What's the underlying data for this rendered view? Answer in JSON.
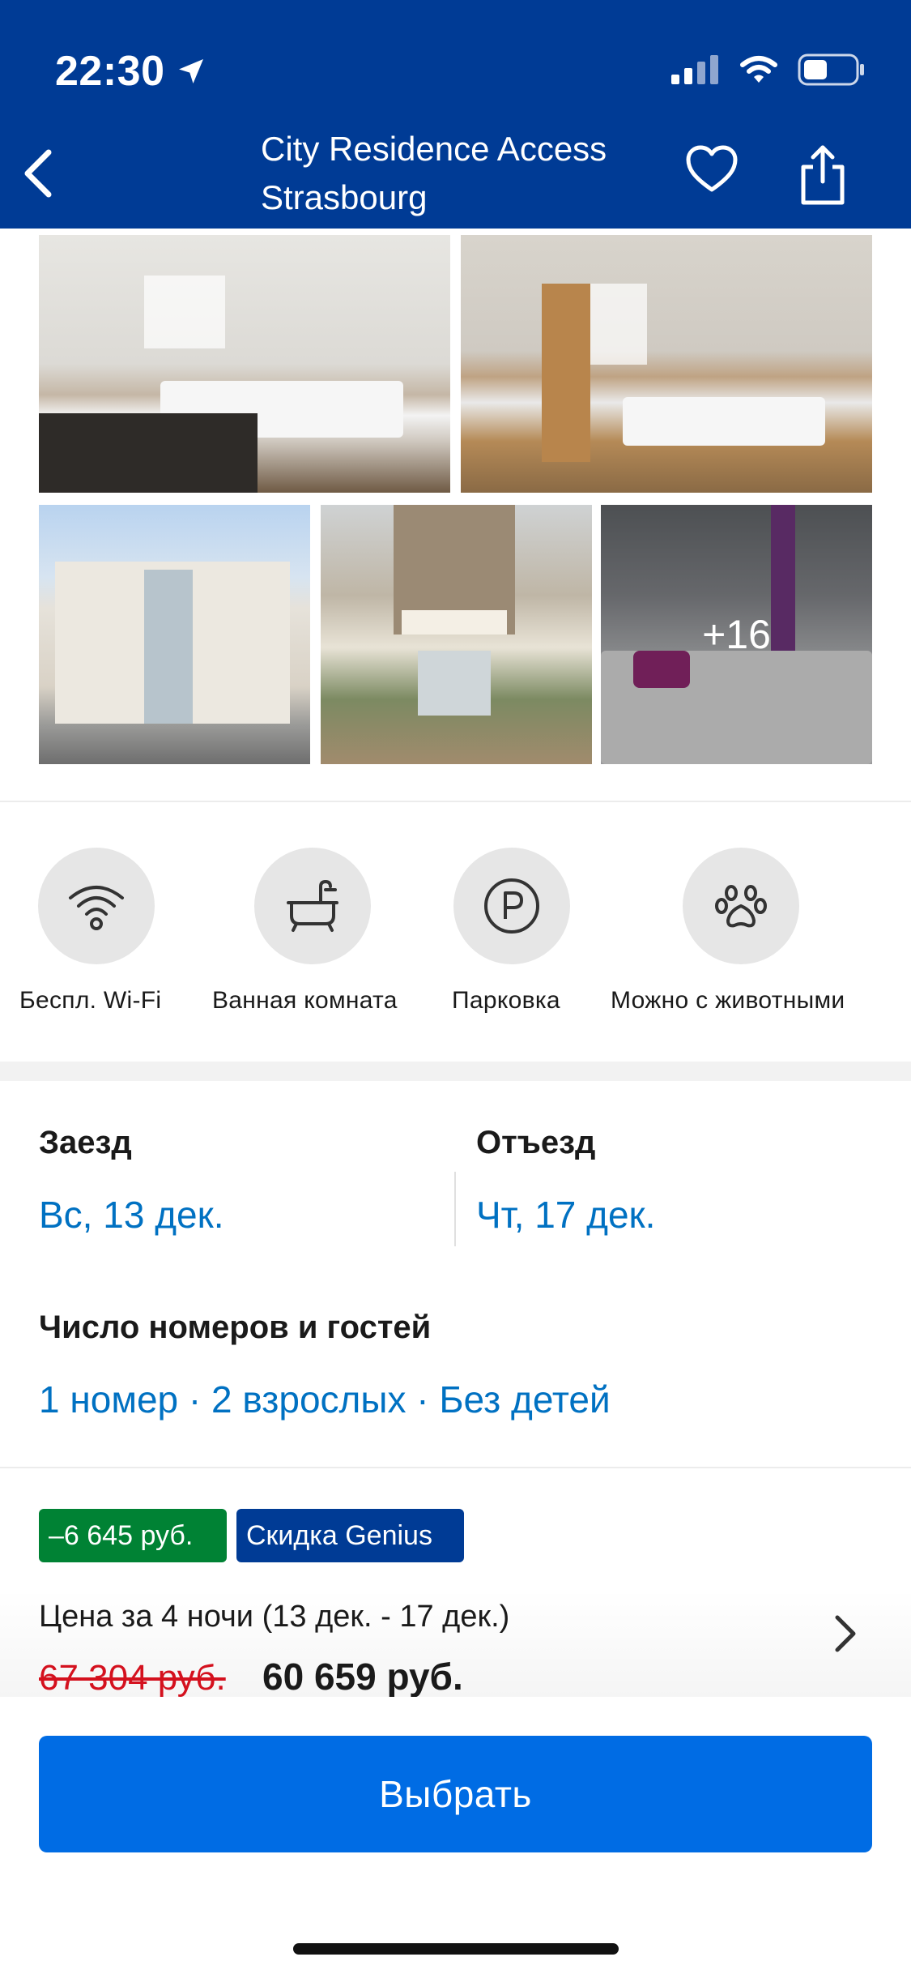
{
  "status_bar": {
    "time": "22:30"
  },
  "header": {
    "title_line1": "City Residence Access",
    "title_line2": "Strasbourg",
    "back_icon": "chevron-left-icon",
    "favorite_icon": "heart-icon",
    "share_icon": "share-icon"
  },
  "photos": {
    "more_label": "+16"
  },
  "amenities": [
    {
      "label": "Беспл. Wi-Fi",
      "icon": "wifi-icon"
    },
    {
      "label": "Ванная комната",
      "icon": "bathtub-icon"
    },
    {
      "label": "Парковка",
      "icon": "parking-icon"
    },
    {
      "label": "Можно с животными",
      "icon": "paw-icon"
    }
  ],
  "dates": {
    "checkin_label": "Заезд",
    "checkin_value": "Вс, 13 дек.",
    "checkout_label": "Отъезд",
    "checkout_value": "Чт, 17 дек."
  },
  "guests": {
    "label": "Число номеров и гостей",
    "value": "1 номер · 2 взрослых · Без детей"
  },
  "price": {
    "discount_badge": "–6 645 руб.",
    "genius_badge": "Скидка Genius",
    "caption": "Цена за 4 ночи (13 дек. - 17 дек.)",
    "old_price": "67 304 руб.",
    "new_price": "60 659 руб."
  },
  "actions": {
    "select_label": "Выбрать"
  },
  "colors": {
    "brand_blue": "#003b95",
    "link_blue": "#0071c2",
    "button_blue": "#006ce4",
    "discount_green": "#008234",
    "strike_red": "#d4111e"
  }
}
